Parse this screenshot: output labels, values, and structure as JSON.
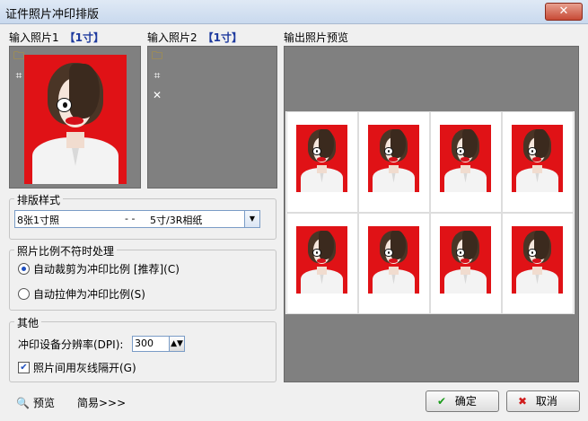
{
  "window": {
    "title": "证件照片冲印排版",
    "close_glyph": "✕"
  },
  "input1": {
    "label": "输入照片1",
    "size": "【1寸】"
  },
  "input2": {
    "label": "输入照片2",
    "size": "【1寸】"
  },
  "preview": {
    "label": "输出照片预览",
    "rows": 2,
    "cols": 4
  },
  "layout_style": {
    "legend": "排版样式",
    "selected_left": "8张1寸照",
    "selected_mid": "- -",
    "selected_right": "5寸/3R相纸"
  },
  "ratio_mismatch": {
    "legend": "照片比例不符时处理",
    "option_crop": "自动裁剪为冲印比例 [推荐](C)",
    "option_stretch": "自动拉伸为冲印比例(S)",
    "selected": "crop"
  },
  "other": {
    "legend": "其他",
    "dpi_label": "冲印设备分辨率(DPI):",
    "dpi_value": "300",
    "gray_line_label": "照片间用灰线隔开(G)",
    "gray_line_checked": true
  },
  "footer": {
    "preview_link": "预览",
    "simple_link": "简易>>>",
    "ok_label": "确定",
    "cancel_label": "取消"
  },
  "colors": {
    "photo_background": "#e01216",
    "panel": "#808080",
    "accent": "#1e3a9e"
  }
}
